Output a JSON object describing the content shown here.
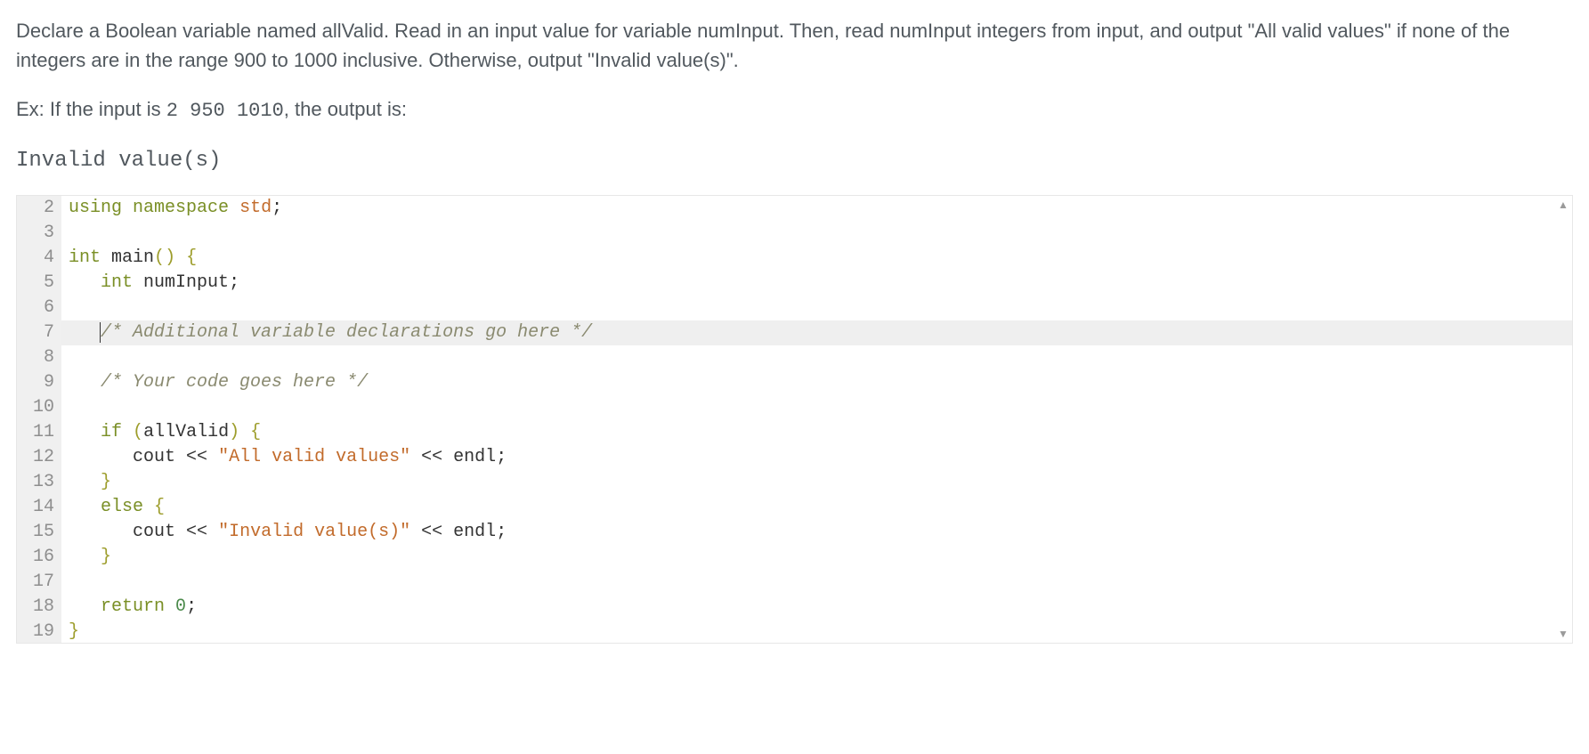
{
  "description": {
    "paragraph1": "Declare a Boolean variable named allValid. Read in an input value for variable numInput. Then, read numInput integers from input, and output \"All valid values\" if none of the integers are in the range 900 to 1000 inclusive. Otherwise, output \"Invalid value(s)\".",
    "example_lead": "Ex: If the input is ",
    "example_input": "2 950 1010",
    "example_trail": ", the output is:",
    "example_output": "Invalid value(s)"
  },
  "editor": {
    "first_line_number": 2,
    "highlighted_line_number": 7,
    "lines": {
      "2": {
        "kw_using": "using",
        "kw_namespace": "namespace",
        "ns": "std",
        "semi": ";"
      },
      "3": {
        "blank": ""
      },
      "4": {
        "type": "int",
        "fn": "main",
        "paren_open": "(",
        "paren_close": ")",
        "brace_open": "{"
      },
      "5": {
        "indent": "   ",
        "type": "int",
        "id": "numInput",
        "semi": ";"
      },
      "6": {
        "blank": ""
      },
      "7": {
        "indent": "   ",
        "comment": "/* Additional variable declarations go here */"
      },
      "8": {
        "blank": ""
      },
      "9": {
        "indent": "   ",
        "comment": "/* Your code goes here */"
      },
      "10": {
        "blank": ""
      },
      "11": {
        "indent": "   ",
        "kw_if": "if",
        "paren_open": "(",
        "id": "allValid",
        "paren_close": ")",
        "brace_open": "{"
      },
      "12": {
        "indent": "      ",
        "id": "cout",
        "op1": "<<",
        "str": "\"All valid values\"",
        "op2": "<<",
        "endl": "endl",
        "semi": ";"
      },
      "13": {
        "indent": "   ",
        "brace_close": "}"
      },
      "14": {
        "indent": "   ",
        "kw_else": "else",
        "brace_open": "{"
      },
      "15": {
        "indent": "      ",
        "id": "cout",
        "op1": "<<",
        "str": "\"Invalid value(s)\"",
        "op2": "<<",
        "endl": "endl",
        "semi": ";"
      },
      "16": {
        "indent": "   ",
        "brace_close": "}"
      },
      "17": {
        "blank": ""
      },
      "18": {
        "indent": "   ",
        "kw_return": "return",
        "num": "0",
        "semi": ";"
      },
      "19": {
        "brace_close": "}"
      }
    }
  }
}
